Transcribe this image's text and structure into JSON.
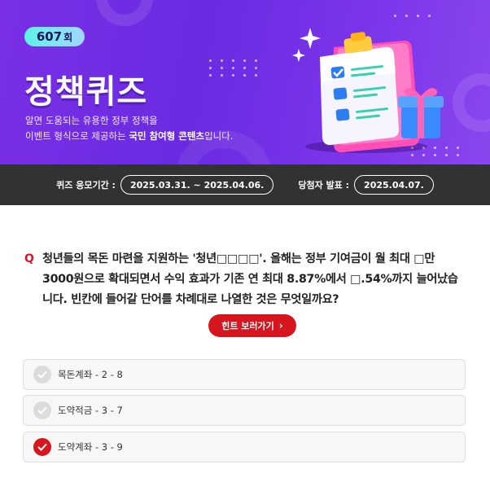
{
  "banner": {
    "episode_number": "607",
    "episode_unit": "회",
    "title": "정책퀴즈",
    "desc_line1": "알면 도움되는 유용한 정부 정책을",
    "desc_line2_prefix": "이벤트 형식으로 제공하는 ",
    "desc_line2_highlight": "국민 참여형 콘텐츠",
    "desc_line2_suffix": "입니다."
  },
  "period": {
    "entry_label": "퀴즈 응모기간 :",
    "entry_value": "2025.03.31. ~ 2025.04.06.",
    "announce_label": "당첨자 발표 :",
    "announce_value": "2025.04.07."
  },
  "question": {
    "marker": "Q",
    "text": "청년들의 목돈 마련을 지원하는 '청년□□□□'. 올해는 정부 기여금이 월 최대 □만 3000원으로 확대되면서 수익 효과가 기존 연 최대 8.87%에서 □.54%까지 늘어났습니다. 빈칸에 들어갈 단어를 차례대로 나열한 것은 무엇일까요?"
  },
  "hint_button": {
    "label": "힌트 보러가기",
    "chevron": "›"
  },
  "options": [
    {
      "label": "목돈계좌 - 2 - 8",
      "selected": false
    },
    {
      "label": "도약적금 - 3 - 7",
      "selected": false
    },
    {
      "label": "도약계좌 - 3 - 9",
      "selected": true
    }
  ],
  "colors": {
    "banner_purple": "#7a2fe6",
    "accent_red": "#d7151f",
    "period_bar": "#323232",
    "badge_cyan": "#5ef2e6"
  },
  "icons": {
    "check": "check-icon",
    "chevron": "chevron-right-icon",
    "illustration": "clipboard-checklist-illustration"
  }
}
